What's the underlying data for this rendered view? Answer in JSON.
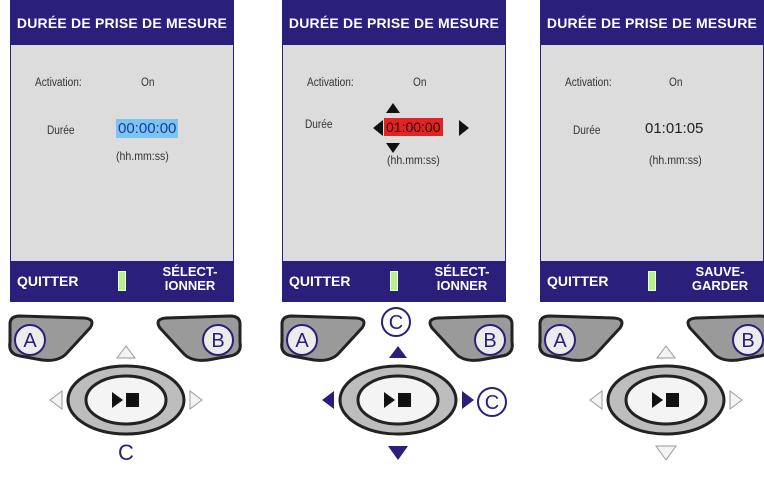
{
  "panels": [
    {
      "title": "DURÉE DE PRISE DE MESURE",
      "activation_label": "Activation:",
      "activation_value": "On",
      "duration_label": "Durée",
      "duration_value": "00:00:00",
      "duration_hint": "(hh.mm:ss)",
      "soft_left": "QUITTER",
      "soft_right_line1": "SÉLECT-",
      "soft_right_line2": "IONNER",
      "button_a": "A",
      "button_b": "B",
      "key_label": "C"
    },
    {
      "title": "DURÉE DE PRISE DE MESURE",
      "activation_label": "Activation:",
      "activation_value": "On",
      "duration_label": "Durée",
      "duration_value": "01:00:00",
      "duration_hint": "(hh.mm:ss)",
      "soft_left": "QUITTER",
      "soft_right_line1": "SÉLECT-",
      "soft_right_line2": "IONNER",
      "button_a": "A",
      "button_b": "B",
      "key_label_top": "C",
      "key_label_right": "C"
    },
    {
      "title": "DURÉE DE PRISE DE MESURE",
      "activation_label": "Activation:",
      "activation_value": "On",
      "duration_label": "Durée",
      "duration_value": "01:01:05",
      "duration_hint": "(hh.mm:ss)",
      "soft_left": "QUITTER",
      "soft_right_line1": "SAUVE-",
      "soft_right_line2": "GARDER",
      "button_a": "A",
      "button_b": "B"
    }
  ],
  "colors": {
    "title_bar": "#2a1f7a",
    "screen_bg": "#dcdcdc",
    "highlight_blue": "#7cc4f0",
    "highlight_red": "#e52222",
    "arrow_blue": "#2a1f7a"
  }
}
